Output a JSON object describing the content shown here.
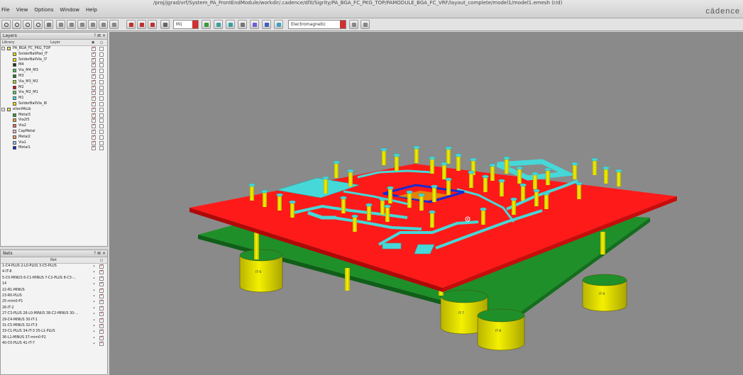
{
  "window": {
    "title": "/proj/jgrad/vrf/System_PA_FrontEndModule/workdir/.cadence/dfII/Sigrity/PA_BGA_FC_PKG_TOP/PAMODULE_BGA_FC_VRF/layout_complete/model1/model1.emesh (r/d)",
    "brand": "cādence"
  },
  "menu": [
    "File",
    "View",
    "Options",
    "Window",
    "Help"
  ],
  "toolbar": {
    "layer_select": "M1",
    "mode_select": "Electromagnetic"
  },
  "layers_panel": {
    "title": "Layers",
    "col_library": "Library",
    "col_layer": "Layer",
    "groups": [
      {
        "name": "PA_BGA_FC_PKG_TOP",
        "color": "#e8e060",
        "items": [
          {
            "label": "SolderBallPad_IT",
            "color": "#f0e000"
          },
          {
            "label": "SolderBallVia_I7",
            "color": "#f0e000"
          },
          {
            "label": "M4",
            "color": "#203020"
          },
          {
            "label": "Via_M4_M3",
            "color": "#50c050"
          },
          {
            "label": "M3",
            "color": "#208020"
          },
          {
            "label": "Via_M3_M2",
            "color": "#a0e030"
          },
          {
            "label": "M2",
            "color": "#d01010"
          },
          {
            "label": "Via_M2_M1",
            "color": "#60d060"
          },
          {
            "label": "M1",
            "color": "#40e0e0"
          },
          {
            "label": "SolderBallVia_I6",
            "color": "#f0e000"
          }
        ]
      },
      {
        "name": "ellenPALib",
        "color": "#e8e060",
        "items": [
          {
            "label": "Metal3",
            "color": "#30a030"
          },
          {
            "label": "Via2l5",
            "color": "#e0a040"
          },
          {
            "label": "Via2",
            "color": "#e07060"
          },
          {
            "label": "CapMetal",
            "color": "#f0c0c0"
          },
          {
            "label": "Metal2",
            "color": "#e8a070"
          },
          {
            "label": "Via1",
            "color": "#a0c0e0"
          },
          {
            "label": "Metal1",
            "color": "#1020c0"
          }
        ]
      }
    ]
  },
  "nets_panel": {
    "title": "Nets",
    "col_net": "Net",
    "nets": [
      "1-C4-PLUS 2-L0-PLUS 3-C5-PLUS",
      "4-IT-8",
      "5-C0-MINUS 6-C1-MINUS 7-C2-PLUS 8-C3-...",
      "14",
      "22-R1-MINUS",
      "23-R0-PLUS",
      "25-mim0-P1",
      "26-IT-2",
      "27-C3-PLUS 28-L0-MINUS 38-C2-MINUS 30-...",
      "29-C4-MINUS 30-IT-1",
      "31-C5-MINUS 32-IT-3",
      "33-C1-PLUS 34-IT-3 35-L1-PLUS",
      "36-L1-MINUS 37-mim0-P2",
      "40-C0-PLUS 41-IT-7"
    ]
  },
  "scene": {
    "ball_labels": [
      "IT-6",
      "IT-7",
      "IT-8",
      "IT-9"
    ],
    "colors": {
      "background": "#8a8a8a",
      "top_board": "#ff1a1a",
      "bottom_board": "#1f8f2a",
      "via": "#e6e200",
      "trace": "#46d8d8",
      "metal1": "#1a2ad0"
    }
  }
}
